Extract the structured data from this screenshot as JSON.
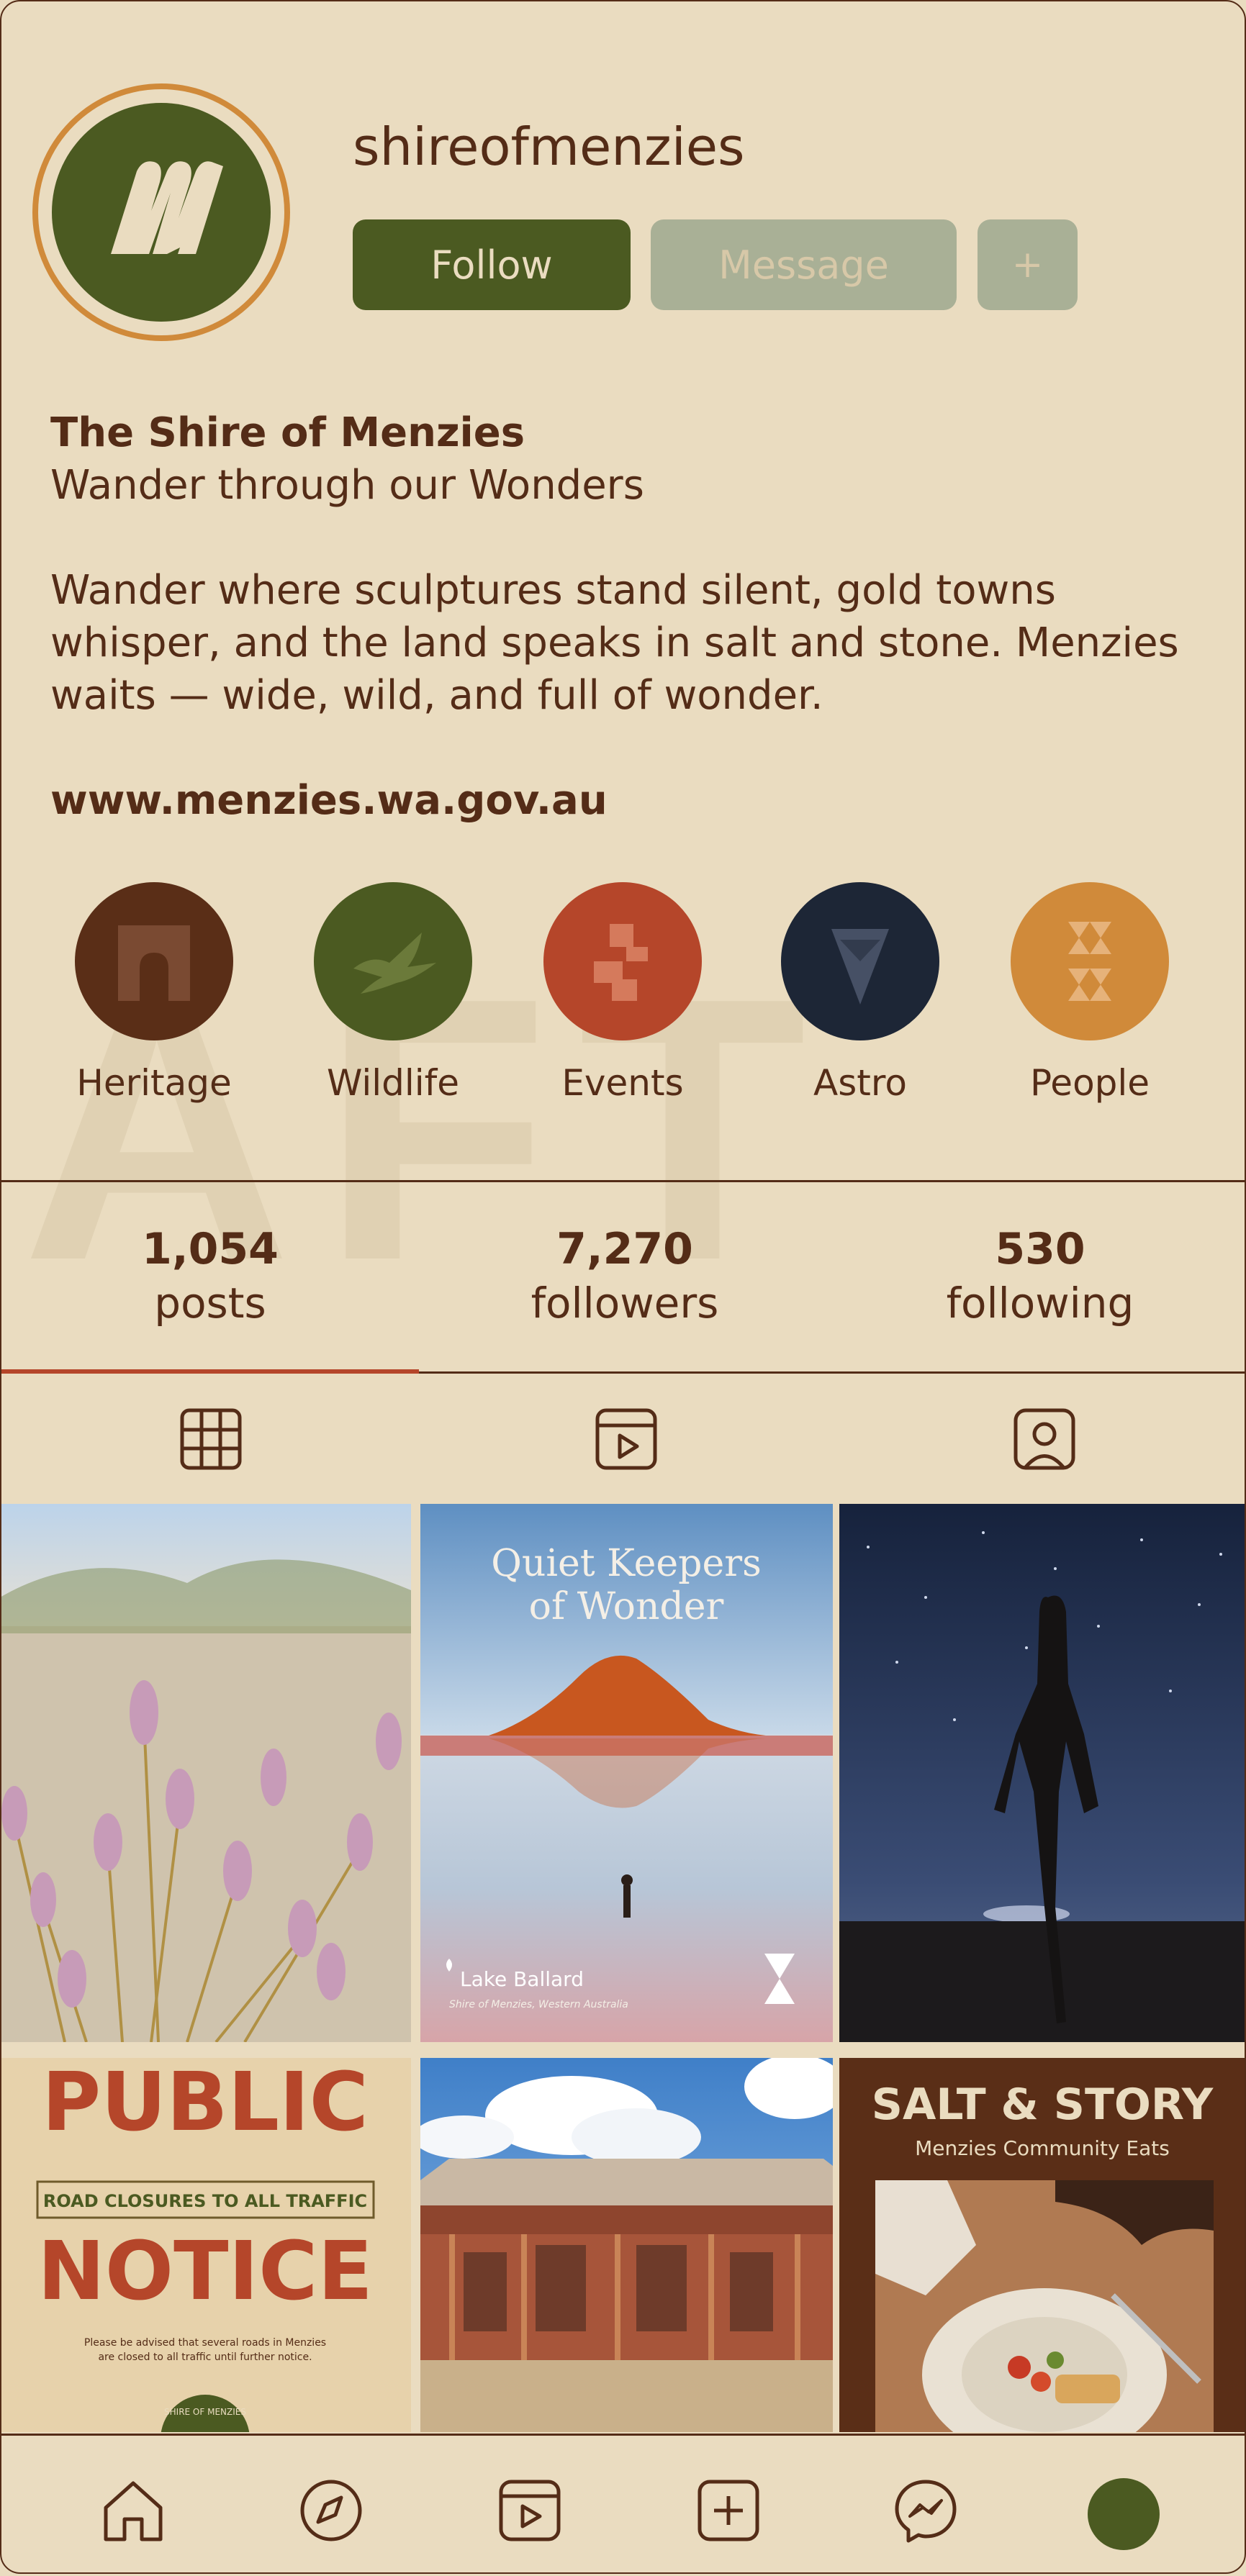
{
  "profile": {
    "username": "shireofmenzies",
    "follow_label": "Follow",
    "message_label": "Message",
    "more_label": "+",
    "bio_name": "The Shire of Menzies",
    "bio_tagline": "Wander through our Wonders",
    "bio_description": "Wander where sculptures stand silent, gold towns whisper, and the land speaks in salt and stone. Menzies waits — wide, wild, and full of wonder.",
    "website": "www.menzies.wa.gov.au",
    "avatar_icon": "menzies-m-logo"
  },
  "watermark": "AFT",
  "highlights": [
    {
      "label": "Heritage",
      "color": "#5a2e17",
      "icon": "archway-icon"
    },
    {
      "label": "Wildlife",
      "color": "#4b5a21",
      "icon": "bird-icon"
    },
    {
      "label": "Events",
      "color": "#b5462a",
      "icon": "stepped-blocks-icon"
    },
    {
      "label": "Astro",
      "color": "#1d2636",
      "icon": "triangle-stack-icon"
    },
    {
      "label": "People",
      "color": "#d08a3a",
      "icon": "hourglass-figure-icon"
    }
  ],
  "stats": [
    {
      "value": "1,054",
      "label": "posts"
    },
    {
      "value": "7,270",
      "label": "followers"
    },
    {
      "value": "530",
      "label": "following"
    }
  ],
  "tabs": [
    {
      "icon": "grid-icon",
      "active": true
    },
    {
      "icon": "reels-icon",
      "active": false
    },
    {
      "icon": "tagged-icon",
      "active": false
    }
  ],
  "posts": {
    "lake_title_line1": "Quiet Keepers",
    "lake_title_line2": "of Wonder",
    "lake_location": "Lake Ballard",
    "lake_sub": "Shire of Menzies, Western Australia",
    "notice_title1": "PUBLIC",
    "notice_banner": "ROAD CLOSURES TO ALL TRAFFIC",
    "notice_title2": "NOTICE",
    "notice_body_line1": "Please be advised that several roads in Menzies",
    "notice_body_line2": "are closed to all traffic until further notice.",
    "notice_seal_text": "SHIRE OF MENZIES",
    "salt_title": "SALT & STORY",
    "salt_sub": "Menzies Community Eats"
  },
  "bottom_nav": [
    {
      "icon": "home-icon"
    },
    {
      "icon": "explore-icon"
    },
    {
      "icon": "reels-icon"
    },
    {
      "icon": "create-icon"
    },
    {
      "icon": "messenger-icon"
    },
    {
      "icon": "profile-avatar"
    }
  ],
  "colors": {
    "background": "#eadcc0",
    "brown": "#542c17",
    "olive": "#4b5a21",
    "rust": "#b5462a",
    "ochre": "#d08a3a",
    "navy": "#1d2636",
    "muted_button": "#a9b096"
  }
}
